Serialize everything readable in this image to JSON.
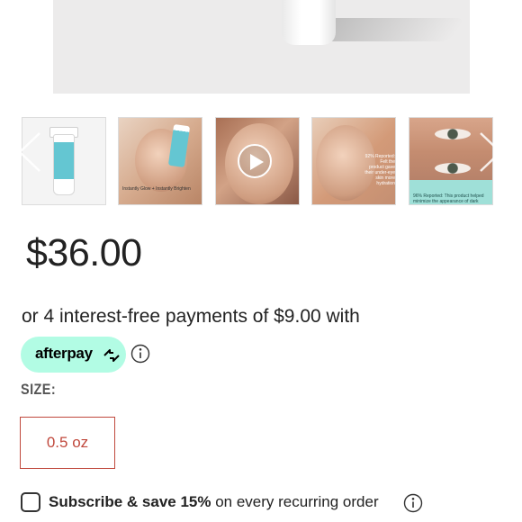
{
  "product": {
    "price": "$36.00"
  },
  "installments": {
    "text": "or 4 interest-free payments of $9.00 with",
    "provider_label": "afterpay"
  },
  "size": {
    "label": "SIZE:",
    "options": [
      {
        "label": "0.5 oz",
        "selected": true
      }
    ]
  },
  "subscribe": {
    "bold_text": "Subscribe & save 15%",
    "rest_text": " on every recurring order",
    "checked": false
  },
  "gallery": {
    "thumbnails": [
      {
        "caption": ""
      },
      {
        "caption": "Instantly Glow + Instantly Brighten"
      },
      {
        "caption": ""
      },
      {
        "caption": "92% Reported: Felt the product gave their under-eye skin more hydration"
      },
      {
        "caption": "96% Reported: This product helped minimize the appearance of dark circles"
      }
    ]
  },
  "colors": {
    "accent": "#c0483c",
    "afterpay_mint": "#b2fce4",
    "text": "#222222"
  },
  "icons": {
    "afterpay_logo": "afterpay-arrows-icon",
    "info": "info-circle-icon",
    "play": "play-icon",
    "prev": "chevron-left-icon",
    "next": "chevron-right-icon"
  }
}
